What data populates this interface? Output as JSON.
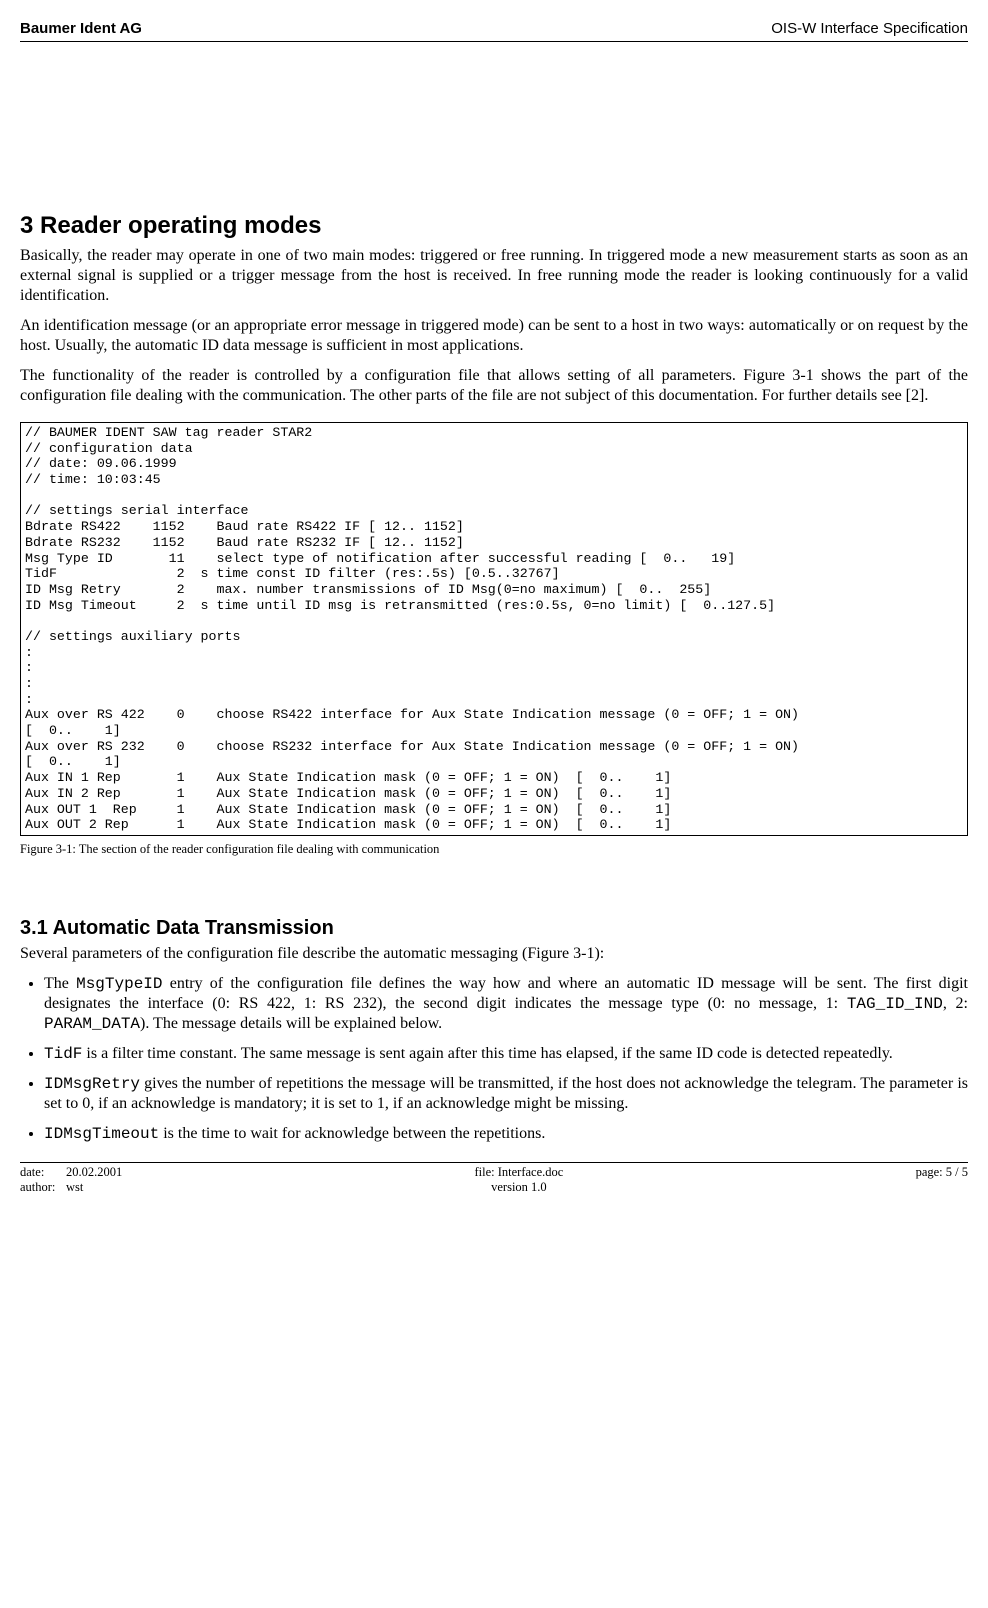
{
  "header": {
    "company": "Baumer Ident AG",
    "doc_title": "OIS-W Interface Specification"
  },
  "section3": {
    "heading": "3  Reader operating modes",
    "p1": "Basically, the reader may operate in one of two main modes: triggered or free running. In triggered mode a new measurement starts as soon as an external signal is supplied or a trigger message from the host is received. In free running mode the reader is looking continuously for a valid identification.",
    "p2": "An identification message (or an appropriate error message in triggered mode) can be sent to a host in two ways: automatically or on request by the host. Usually, the automatic ID data message is sufficient in most applications.",
    "p3": "The functionality of the reader is controlled by a configuration file that allows setting of all parameters. Figure 3-1 shows the part of the configuration file dealing with the communication. The other parts of the file are not subject of this documentation. For further details see [2]."
  },
  "config_file": "// BAUMER IDENT SAW tag reader STAR2\n// configuration data\n// date: 09.06.1999\n// time: 10:03:45\n\n// settings serial interface\nBdrate RS422    1152    Baud rate RS422 IF [ 12.. 1152]\nBdrate RS232    1152    Baud rate RS232 IF [ 12.. 1152]\nMsg Type ID       11    select type of notification after successful reading [  0..   19]\nTidF               2  s time const ID filter (res:.5s) [0.5..32767]\nID Msg Retry       2    max. number transmissions of ID Msg(0=no maximum) [  0..  255]\nID Msg Timeout     2  s time until ID msg is retransmitted (res:0.5s, 0=no limit) [  0..127.5]\n\n// settings auxiliary ports\n:\n:\n:\n:\nAux over RS 422    0    choose RS422 interface for Aux State Indication message (0 = OFF; 1 = ON)\n[  0..    1]\nAux over RS 232    0    choose RS232 interface for Aux State Indication message (0 = OFF; 1 = ON)\n[  0..    1]\nAux IN 1 Rep       1    Aux State Indication mask (0 = OFF; 1 = ON)  [  0..    1]\nAux IN 2 Rep       1    Aux State Indication mask (0 = OFF; 1 = ON)  [  0..    1]\nAux OUT 1  Rep     1    Aux State Indication mask (0 = OFF; 1 = ON)  [  0..    1]\nAux OUT 2 Rep      1    Aux State Indication mask (0 = OFF; 1 = ON)  [  0..    1]",
  "figure_caption": "Figure 3-1: The section of the reader configuration file dealing with communication",
  "section31": {
    "heading": "3.1  Automatic Data Transmission",
    "intro": "Several parameters of the configuration file describe the automatic messaging (Figure 3-1):",
    "b1a": "The ",
    "b1b": "MsgTypeID",
    "b1c": " entry of the configuration file defines the way how and where an automatic ID message will be sent. The first digit designates the interface (0: RS 422, 1: RS 232), the second digit indicates the message type (0: no message, 1: ",
    "b1d": "TAG_ID_IND",
    "b1e": ", 2: ",
    "b1f": "PARAM_DATA",
    "b1g": "). The message details will be explained below.",
    "b2a": "TidF",
    "b2b": " is a filter time constant. The same message is sent again after this time has elapsed, if the same ID code is detected repeatedly.",
    "b3a": "IDMsgRetry",
    "b3b": " gives the number of repetitions the message will be transmitted, if the host does not acknowledge the telegram. The parameter is set to 0, if an acknowledge is mandatory; it is set to 1, if an acknowledge might be missing.",
    "b4a": "IDMsgTimeout",
    "b4b": " is the time to wait for acknowledge between the repetitions."
  },
  "footer": {
    "date_label": "date:",
    "date_value": "20.02.2001",
    "author_label": "author:",
    "author_value": "wst",
    "file_label": "file: Interface.doc",
    "version_label": "version 1.0",
    "page_label": "page: 5 / 5"
  }
}
